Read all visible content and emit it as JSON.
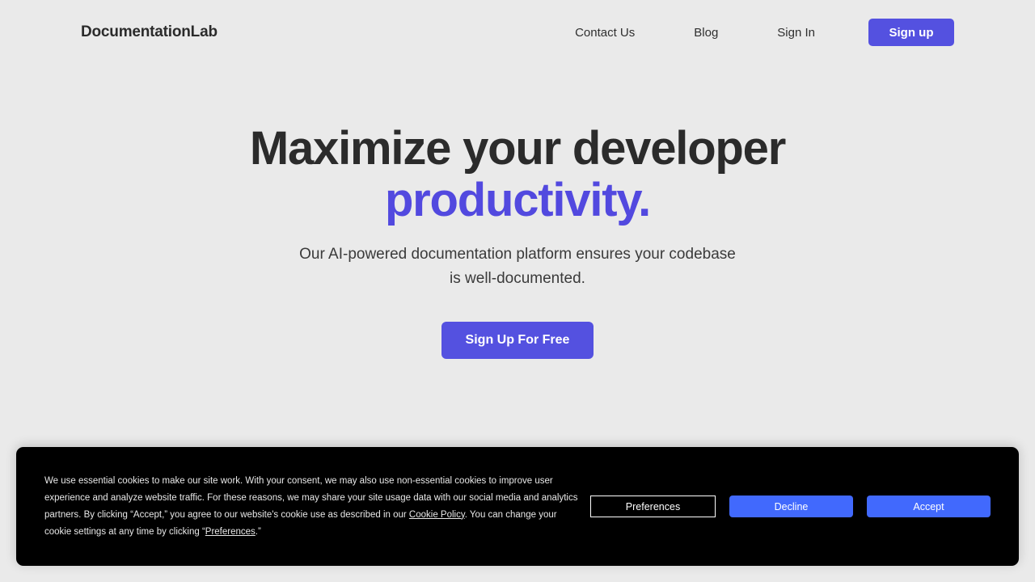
{
  "header": {
    "brand": "DocumentationLab",
    "nav": [
      {
        "label": "Contact Us"
      },
      {
        "label": "Blog"
      },
      {
        "label": "Sign In"
      }
    ],
    "signup_label": "Sign up"
  },
  "hero": {
    "title_line1": "Maximize your developer",
    "title_accent": "productivity.",
    "subtitle_line1": "Our AI-powered documentation platform ensures your codebase",
    "subtitle_line2": "is well-documented.",
    "cta_label": "Sign Up For Free"
  },
  "cookie_banner": {
    "text_part1": "We use essential cookies to make our site work. With your consent, we may also use non-essential cookies to improve user experience and analyze website traffic. For these reasons, we may share your site usage data with our social media and analytics partners. By clicking “Accept,” you agree to our website's cookie use as described in our ",
    "cookie_policy_link": "Cookie Policy",
    "text_part2": ". You can change your cookie settings at any time by clicking “",
    "preferences_link": "Preferences",
    "text_part3": ".”",
    "preferences_label": "Preferences",
    "decline_label": "Decline",
    "accept_label": "Accept"
  },
  "colors": {
    "page_background": "#eaeaea",
    "brand_purple": "#5451e0",
    "accent_purple": "#5249df",
    "banner_background": "#000000",
    "banner_button_blue": "#4169fd",
    "heading_text": "#2b2b2b"
  }
}
